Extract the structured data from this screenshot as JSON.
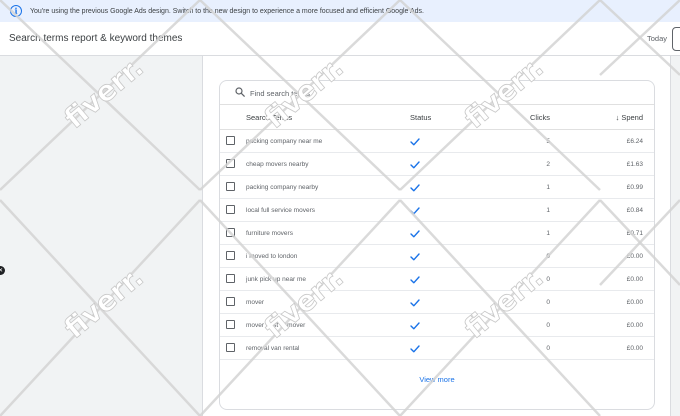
{
  "banner": {
    "text": "You're using the previous Google Ads design. Switch to the new design to experience a more focused and efficient Google Ads.",
    "icon": "info-icon"
  },
  "header": {
    "title": "Search terms report & keyword themes",
    "date_label": "Today"
  },
  "search": {
    "placeholder": "Find search terms"
  },
  "table": {
    "columns": {
      "term": "Search Terms",
      "status": "Status",
      "clicks": "Clicks",
      "spend": "Spend"
    },
    "rows": [
      {
        "term": "packing company near me",
        "clicks": "5",
        "spend": "£6.24"
      },
      {
        "term": "cheap movers nearby",
        "clicks": "2",
        "spend": "£1.63"
      },
      {
        "term": "packing company nearby",
        "clicks": "1",
        "spend": "£0.99"
      },
      {
        "term": "local full service movers",
        "clicks": "1",
        "spend": "£0.84"
      },
      {
        "term": "furniture movers",
        "clicks": "1",
        "spend": "£0.71"
      },
      {
        "term": "i moved to london",
        "clicks": "0",
        "spend": "£0.00"
      },
      {
        "term": "junk pick up near me",
        "clicks": "0",
        "spend": "£0.00"
      },
      {
        "term": "mover",
        "clicks": "0",
        "spend": "£0.00"
      },
      {
        "term": "mover best of mover",
        "clicks": "0",
        "spend": "£0.00"
      },
      {
        "term": "removal van rental",
        "clicks": "0",
        "spend": "£0.00"
      }
    ]
  },
  "view_more": "View more",
  "watermark": {
    "text": "fiverr."
  },
  "colors": {
    "accent": "#1a73e8",
    "banner_bg": "#e8f0fe",
    "page_bg": "#f1f3f4"
  }
}
